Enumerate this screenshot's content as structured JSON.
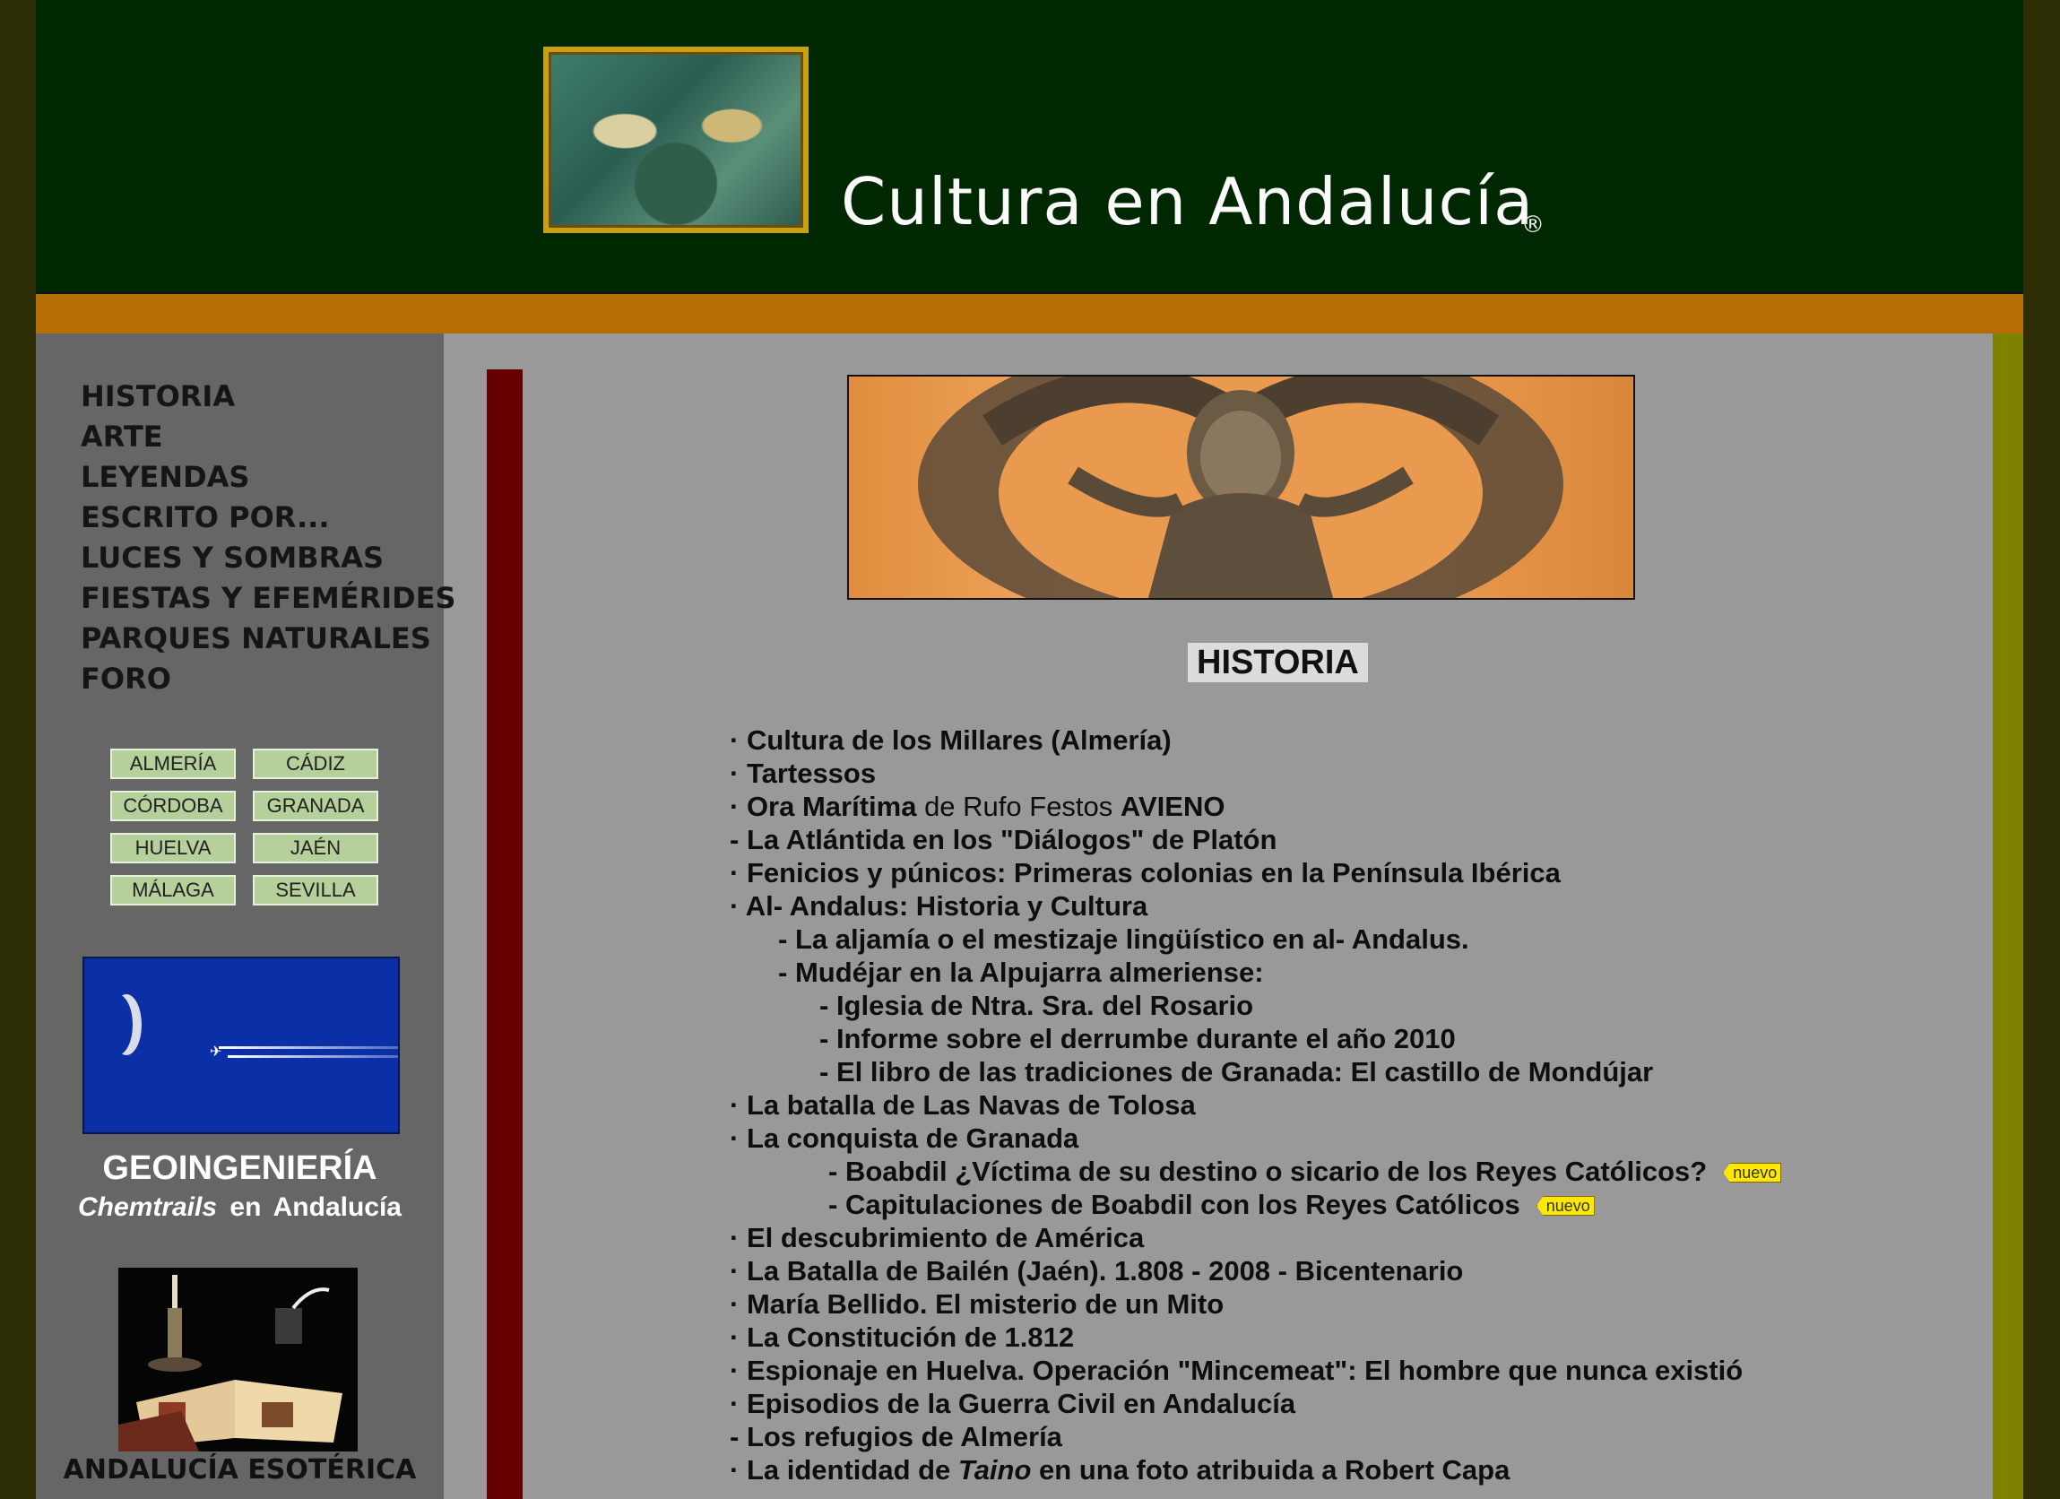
{
  "header": {
    "site_title": "Cultura en Andalucía",
    "registered_mark": "®"
  },
  "sidebar": {
    "nav": [
      "HISTORIA",
      "ARTE",
      "LEYENDAS",
      "ESCRITO POR...",
      "LUCES Y SOMBRAS",
      "FIESTAS Y EFEMÉRIDES",
      "PARQUES NATURALES",
      "FORO"
    ],
    "provinces": [
      "ALMERÍA",
      "CÁDIZ",
      "CÓRDOBA",
      "GRANADA",
      "HUELVA",
      "JAÉN",
      "MÁLAGA",
      "SEVILLA"
    ],
    "geo_title": "GEOINGENIERÍA",
    "geo_subtitle_em": "Chemtrails",
    "geo_subtitle_rest": "en  Andalucía",
    "esoteric_title": "ANDALUCÍA ESOTÉRICA"
  },
  "main": {
    "heading": "HISTORIA",
    "badge": "nuevo",
    "links": [
      {
        "prefix": "· ",
        "text": "Cultura de los Millares (Almería)"
      },
      {
        "prefix": "· ",
        "text": "Tartessos"
      },
      {
        "prefix": "· ",
        "text": "Ora Marítima",
        "mid": " de Rufo Festos ",
        "tail": "AVIENO"
      },
      {
        "prefix": "- ",
        "text": "La Atlántida en los \"Diálogos\" de Platón"
      },
      {
        "prefix": "· ",
        "text": "Fenicios y púnicos: Primeras colonias en la Península Ibérica"
      },
      {
        "prefix": "· ",
        "text": "Al- Andalus: Historia y Cultura"
      },
      {
        "prefix": "- ",
        "text": "La aljamía o el mestizaje lingüístico en al- Andalus.",
        "indent": 1
      },
      {
        "prefix": "- ",
        "text": "Mudéjar en la Alpujarra almeriense:",
        "indent": 1
      },
      {
        "prefix": "- ",
        "text": "Iglesia de Ntra. Sra. del Rosario",
        "indent": 2
      },
      {
        "prefix": "- ",
        "text": "Informe sobre el derrumbe durante el año 2010",
        "indent": 2
      },
      {
        "prefix": "- ",
        "text": "El libro de las tradiciones de Granada: El castillo de Mondújar",
        "indent": 2
      },
      {
        "prefix": "· ",
        "text": "La batalla de Las Navas de Tolosa"
      },
      {
        "prefix": "· ",
        "text": "La conquista de Granada"
      },
      {
        "prefix": "- ",
        "text": "Boabdil ¿Víctima de su destino o sicario de los Reyes Católicos?",
        "indent": 3,
        "new": true
      },
      {
        "prefix": "- ",
        "text": "Capitulaciones de Boabdil con los Reyes Católicos",
        "indent": 3,
        "new": true
      },
      {
        "prefix": "· ",
        "text": "El descubrimiento de América"
      },
      {
        "prefix": "· ",
        "text": "La Batalla de Bailén (Jaén). 1.808 - 2008 - Bicentenario"
      },
      {
        "prefix": "· ",
        "text": "María Bellido. El misterio de un Mito"
      },
      {
        "prefix": "· ",
        "text": "La Constitución de 1.812"
      },
      {
        "prefix": "· ",
        "text": "Espionaje en Huelva. Operación \"Mincemeat\": El hombre que nunca existió"
      },
      {
        "prefix": "· ",
        "text": "Episodios de la Guerra Civil en Andalucía"
      },
      {
        "prefix": "- ",
        "text": "Los refugios de Almería"
      },
      {
        "prefix": "· ",
        "text": "La identidad de ",
        "em": "Taino",
        "tail": " en una foto atribuida a Robert Capa",
        "tail_bold": true
      }
    ]
  }
}
